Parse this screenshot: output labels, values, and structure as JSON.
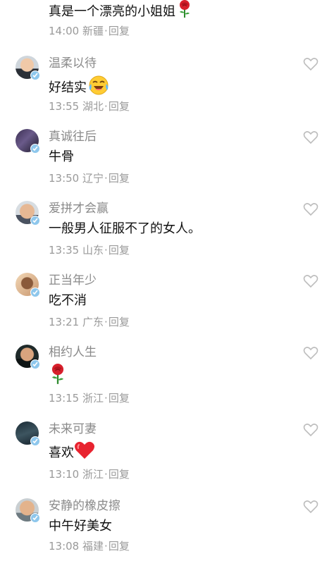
{
  "reply_label": "回复",
  "meta_separator": "·",
  "first_comment": {
    "content": "真是一个漂亮的小姐姐",
    "time": "14:00",
    "location": "新疆",
    "emoji": "rose-icon"
  },
  "comments": [
    {
      "username": "温柔以待",
      "content": "好结实",
      "emoji": "laughing-tears-icon",
      "time": "13:55",
      "location": "湖北"
    },
    {
      "username": "真诚往后",
      "content": "牛骨",
      "emoji": "",
      "time": "13:50",
      "location": "辽宁"
    },
    {
      "username": "爱拼才会赢",
      "content": "一般男人征服不了的女人。",
      "emoji": "",
      "time": "13:35",
      "location": "山东"
    },
    {
      "username": "正当年少",
      "content": "吃不消",
      "emoji": "",
      "time": "13:21",
      "location": "广东"
    },
    {
      "username": "相约人生",
      "content": "",
      "emoji": "rose-icon",
      "time": "13:15",
      "location": "浙江"
    },
    {
      "username": "未来可妻",
      "content": "喜欢",
      "emoji": "red-heart-icon",
      "time": "13:10",
      "location": "浙江"
    },
    {
      "username": "安静的橡皮擦",
      "content": "中午好美女",
      "emoji": "",
      "time": "13:08",
      "location": "福建"
    }
  ],
  "colors": {
    "username": "#8a8a8a",
    "content": "#111111",
    "meta": "#9a9a9a",
    "verified_badge": "#8ec7ec",
    "like_outline": "#bdbdbd",
    "rose": "#d8202c",
    "heart": "#e8232f"
  }
}
